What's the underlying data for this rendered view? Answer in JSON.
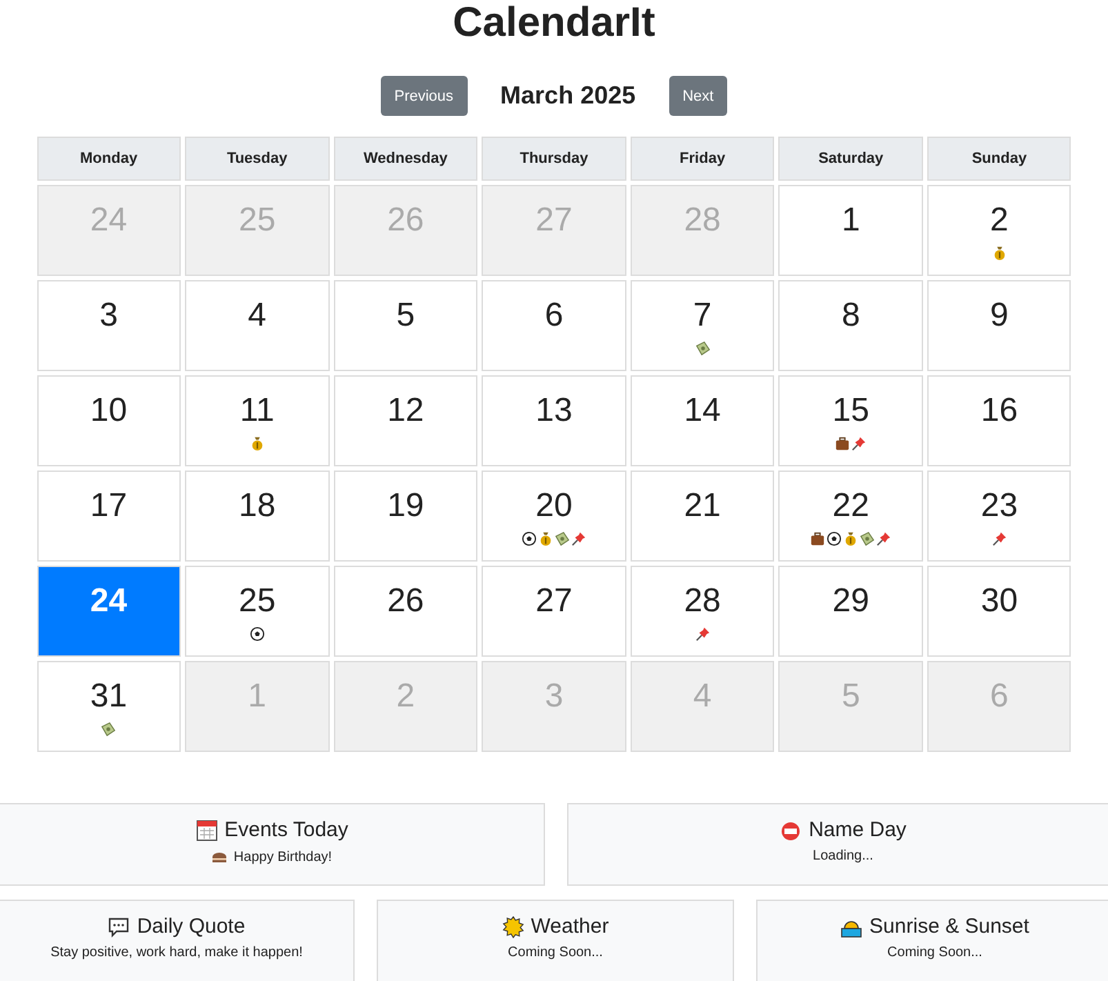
{
  "title": "CalendarIt",
  "nav": {
    "previous": "Previous",
    "month": "March 2025",
    "next": "Next"
  },
  "weekdays": [
    "Monday",
    "Tuesday",
    "Wednesday",
    "Thursday",
    "Friday",
    "Saturday",
    "Sunday"
  ],
  "weeks": [
    [
      {
        "day": "24",
        "outside": true,
        "selected": false
      },
      {
        "day": "25",
        "outside": true,
        "selected": false
      },
      {
        "day": "26",
        "outside": true,
        "selected": false
      },
      {
        "day": "27",
        "outside": true,
        "selected": false
      },
      {
        "day": "28",
        "outside": true,
        "selected": false
      },
      {
        "day": "1",
        "outside": false,
        "selected": false
      },
      {
        "day": "2",
        "outside": false,
        "selected": false,
        "events": [
          {
            "kind": "moneybag"
          }
        ]
      }
    ],
    [
      {
        "day": "3",
        "outside": false,
        "selected": false
      },
      {
        "day": "4",
        "outside": false,
        "selected": false
      },
      {
        "day": "5",
        "outside": false,
        "selected": false
      },
      {
        "day": "6",
        "outside": false,
        "selected": false
      },
      {
        "day": "7",
        "outside": false,
        "selected": false,
        "events": [
          {
            "kind": "banknote"
          }
        ]
      },
      {
        "day": "8",
        "outside": false,
        "selected": false
      },
      {
        "day": "9",
        "outside": false,
        "selected": false
      }
    ],
    [
      {
        "day": "10",
        "outside": false,
        "selected": false
      },
      {
        "day": "11",
        "outside": false,
        "selected": false,
        "events": [
          {
            "kind": "moneybag"
          }
        ]
      },
      {
        "day": "12",
        "outside": false,
        "selected": false
      },
      {
        "day": "13",
        "outside": false,
        "selected": false
      },
      {
        "day": "14",
        "outside": false,
        "selected": false
      },
      {
        "day": "15",
        "outside": false,
        "selected": false,
        "events": [
          {
            "kind": "briefcase"
          },
          {
            "kind": "pushpin"
          }
        ]
      },
      {
        "day": "16",
        "outside": false,
        "selected": false
      }
    ],
    [
      {
        "day": "17",
        "outside": false,
        "selected": false
      },
      {
        "day": "18",
        "outside": false,
        "selected": false
      },
      {
        "day": "19",
        "outside": false,
        "selected": false
      },
      {
        "day": "20",
        "outside": false,
        "selected": false,
        "events": [
          {
            "kind": "soccer"
          },
          {
            "kind": "moneybag"
          },
          {
            "kind": "banknote"
          },
          {
            "kind": "pushpin"
          }
        ]
      },
      {
        "day": "21",
        "outside": false,
        "selected": false
      },
      {
        "day": "22",
        "outside": false,
        "selected": false,
        "events": [
          {
            "kind": "briefcase"
          },
          {
            "kind": "soccer"
          },
          {
            "kind": "moneybag"
          },
          {
            "kind": "banknote"
          },
          {
            "kind": "pushpin"
          }
        ]
      },
      {
        "day": "23",
        "outside": false,
        "selected": false,
        "events": [
          {
            "kind": "pushpin"
          }
        ]
      }
    ],
    [
      {
        "day": "24",
        "outside": false,
        "selected": true
      },
      {
        "day": "25",
        "outside": false,
        "selected": false,
        "events": [
          {
            "kind": "soccer"
          }
        ]
      },
      {
        "day": "26",
        "outside": false,
        "selected": false
      },
      {
        "day": "27",
        "outside": false,
        "selected": false
      },
      {
        "day": "28",
        "outside": false,
        "selected": false,
        "events": [
          {
            "kind": "pushpin"
          }
        ]
      },
      {
        "day": "29",
        "outside": false,
        "selected": false
      },
      {
        "day": "30",
        "outside": false,
        "selected": false
      }
    ],
    [
      {
        "day": "31",
        "outside": false,
        "selected": false,
        "events": [
          {
            "kind": "banknote"
          }
        ]
      },
      {
        "day": "1",
        "outside": true,
        "selected": false
      },
      {
        "day": "2",
        "outside": true,
        "selected": false
      },
      {
        "day": "3",
        "outside": true,
        "selected": false
      },
      {
        "day": "4",
        "outside": true,
        "selected": false
      },
      {
        "day": "5",
        "outside": true,
        "selected": false
      },
      {
        "day": "6",
        "outside": true,
        "selected": false
      }
    ]
  ],
  "card_rows": [
    [
      {
        "kind": "events",
        "title": "Events Today",
        "text": "Happy Birthday!"
      },
      {
        "kind": "nameday",
        "title": "Name Day",
        "text": "Loading..."
      }
    ],
    [
      {
        "kind": "quote",
        "title": "Daily Quote",
        "text": "Stay positive, work hard, make it happen!"
      },
      {
        "kind": "weather",
        "title": "Weather",
        "text": "Coming Soon..."
      },
      {
        "kind": "sunrise",
        "title": "Sunrise & Sunset",
        "text": "Coming Soon..."
      }
    ]
  ]
}
